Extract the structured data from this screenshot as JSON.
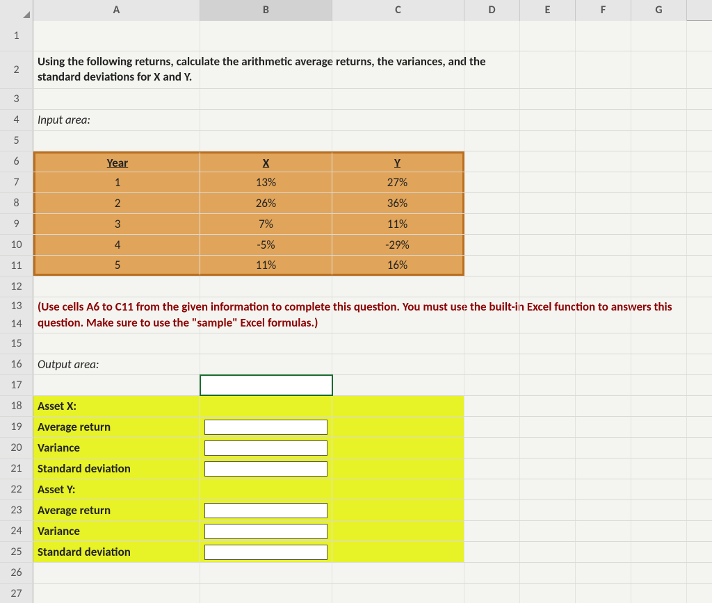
{
  "columns": [
    "A",
    "B",
    "C",
    "D",
    "E",
    "F",
    "G"
  ],
  "active_column": "B",
  "rows": {
    "first": 1,
    "last": 27
  },
  "row2_text": "Using the following returns, calculate the arithmetic average returns, the variances, and the standard deviations for X and Y.",
  "row4_label": "Input area:",
  "input_table": {
    "headers": {
      "year": "Year",
      "x": "X",
      "y": "Y"
    },
    "rows": [
      {
        "year": "1",
        "x": "13%",
        "y": "27%"
      },
      {
        "year": "2",
        "x": "26%",
        "y": "36%"
      },
      {
        "year": "3",
        "x": "7%",
        "y": "11%"
      },
      {
        "year": "4",
        "x": "-5%",
        "y": "-29%"
      },
      {
        "year": "5",
        "x": "11%",
        "y": "16%"
      }
    ]
  },
  "instruction": "(Use cells A6 to C11 from the given information to complete this question. You must use the built-in Excel function to answers this question. Make sure to use the \"sample\" Excel formulas.)",
  "row16_label": "Output area:",
  "output": {
    "asset_x_label": "Asset X:",
    "asset_y_label": "Asset Y:",
    "avg_return_label": "Average return",
    "variance_label": "Variance",
    "stddev_label": "Standard deviation"
  }
}
